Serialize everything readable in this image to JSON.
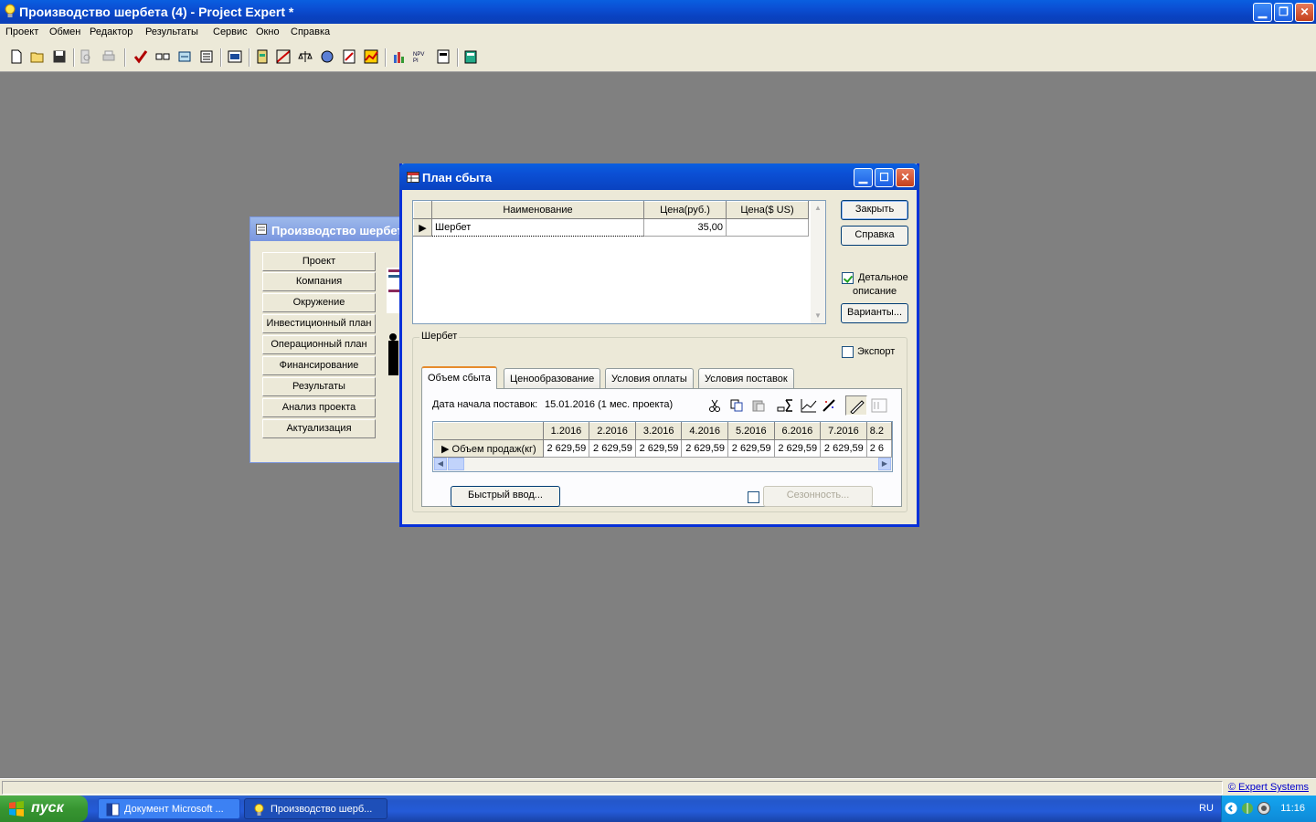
{
  "app": {
    "title": "Производство шербета (4) - Project Expert *"
  },
  "menu": [
    "Проект",
    "Обмен",
    "Редактор",
    "Результаты",
    "Сервис",
    "Окно",
    "Справка"
  ],
  "project_window": {
    "title": "Производство шербет",
    "nav": [
      "Проект",
      "Компания",
      "Окружение",
      "Инвестиционный план",
      "Операционный план",
      "Финансирование",
      "Результаты",
      "Анализ проекта",
      "Актуализация"
    ]
  },
  "sales_dialog": {
    "title": "План сбыта",
    "columns": [
      "Наименование",
      "Цена(руб.)",
      "Цена($ US)"
    ],
    "rows": [
      {
        "name": "Шербет",
        "price_rub": "35,00",
        "price_usd": ""
      }
    ],
    "buttons": {
      "close": "Закрыть",
      "help": "Справка",
      "variants": "Варианты...",
      "quick_input": "Быстрый ввод...",
      "seasonality": "Сезонность..."
    },
    "detail_label_1": "Детальное",
    "detail_label_2": "описание",
    "detail_checked": true,
    "group_title": "Шербет",
    "export_label": "Экспорт",
    "export_checked": false,
    "tabs": [
      "Объем сбыта",
      "Ценообразование",
      "Условия оплаты",
      "Условия поставок"
    ],
    "active_tab": 0,
    "start_date_label": "Дата начала поставок:",
    "start_date_value": "15.01.2016 (1 мес. проекта)",
    "months": [
      "1.2016",
      "2.2016",
      "3.2016",
      "4.2016",
      "5.2016",
      "6.2016",
      "7.2016",
      "8.2"
    ],
    "volume_row_label": "Объем продаж(кг)",
    "volume_values": [
      "2 629,59",
      "2 629,59",
      "2 629,59",
      "2 629,59",
      "2 629,59",
      "2 629,59",
      "2 629,59",
      "2 6"
    ],
    "seasonality_checked": false
  },
  "statusbar": {
    "link": "© Expert Systems"
  },
  "taskbar": {
    "start": "пуск",
    "items": [
      "Документ Microsoft ...",
      "Производство шерб..."
    ],
    "lang": "RU",
    "clock": "11:16"
  }
}
